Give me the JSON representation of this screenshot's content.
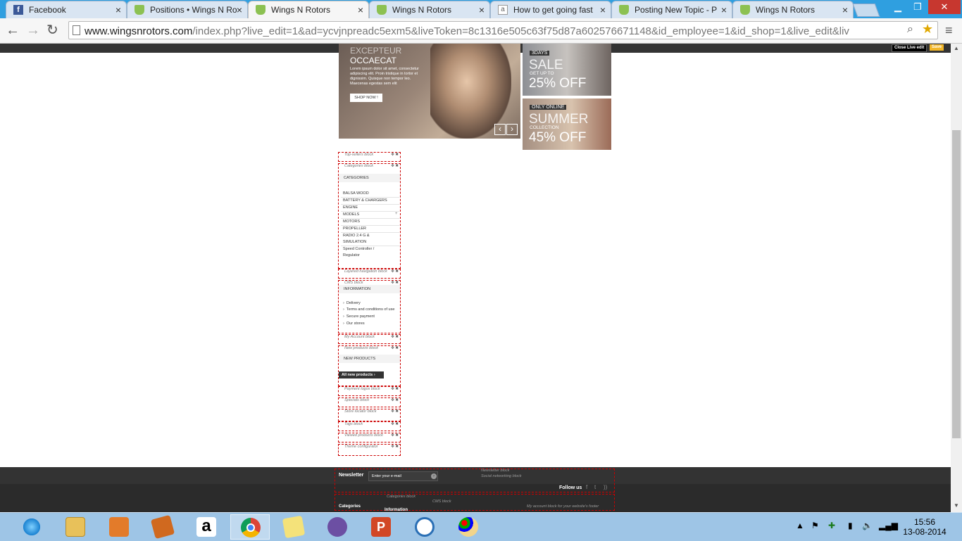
{
  "browser": {
    "tabs": [
      {
        "label": "Facebook",
        "icon": "facebook-icon",
        "active": false
      },
      {
        "label": "Positions • Wings N Ro",
        "icon": "prestashop-icon",
        "active": false
      },
      {
        "label": "Wings N Rotors",
        "icon": "prestashop-icon",
        "active": true
      },
      {
        "label": "Wings N Rotors",
        "icon": "prestashop-icon",
        "active": false
      },
      {
        "label": "How to get going fast",
        "icon": "page-icon",
        "active": false
      },
      {
        "label": "Posting New Topic - P",
        "icon": "prestashop-icon",
        "active": false
      },
      {
        "label": "Wings N Rotors",
        "icon": "prestashop-icon",
        "active": false
      }
    ],
    "url_host": "www.wingsnrotors.com",
    "url_rest": "/index.php?live_edit=1&ad=ycvjnpreadc5exm5&liveToken=8c1316e505c63f75d87a602576671148&id_employee=1&id_shop=1&live_edit&liv"
  },
  "live_edit": {
    "close_label": "Close Live edit",
    "save_label": "Save"
  },
  "slider": {
    "title_line1": "EXCEPTEUR",
    "title_line2": "OCCAECAT",
    "body": "Lorem ipsum dolor sit amet, consectetur adipiscing elit. Proin tristique in tortor et dignissim. Quisque non tempor leo. Maecenas egestas sem elit",
    "button": "SHOP NOW !",
    "prev": "‹",
    "next": "›"
  },
  "promo1": {
    "tag": "3DAYS",
    "big": "SALE",
    "small": "GET UP TO",
    "offer": "25% OFF"
  },
  "promo2": {
    "tag": "ONLY ONLINE",
    "big": "SUMMER",
    "small": "COLLECTION",
    "offer": "45% OFF"
  },
  "left_blocks": {
    "topsellers": "Top-sellers block",
    "categories": "Categories block",
    "layered": "Layered navigation block",
    "cms": "CMS block",
    "myaccount": "My Account block",
    "newproducts": "New products block",
    "paymentlogo": "Payment logos block",
    "specials": "Specials block",
    "storelocator": "Store locator block",
    "tags": "Tags block",
    "viewed": "Viewed products block",
    "themeconfig": "Theme configurator"
  },
  "categories": {
    "heading": "CATEGORIES",
    "items": [
      "BALSA WOOD",
      "BATTERY & CHARGERS",
      "ENGINE",
      "MODELS",
      "MOTORS",
      "PROPELLER",
      "RADIO 2.4 G &",
      "SIMULATION",
      "Speed Controller /",
      "Regulator"
    ],
    "expand": "+"
  },
  "information": {
    "heading": "INFORMATION",
    "items": [
      "Delivery",
      "Terms and conditions of use",
      "Secure payment",
      "Our stores"
    ]
  },
  "new_products": {
    "heading": "NEW PRODUCTS",
    "button": "All new products"
  },
  "footer": {
    "newsletter_label": "Newsletter",
    "newsletter_placeholder": "Enter your e-mail",
    "newsletter_block": "Newsletter block",
    "social_block": "Social networking block",
    "follow_us": "Follow us",
    "categories_block": "Categories block",
    "cms_block": "CMS block",
    "categories_label": "Categories",
    "information_label": "Information",
    "myaccount_footer": "My account block for your website's footer"
  },
  "taskbar": {
    "time": "15:56",
    "date": "13-08-2014"
  }
}
